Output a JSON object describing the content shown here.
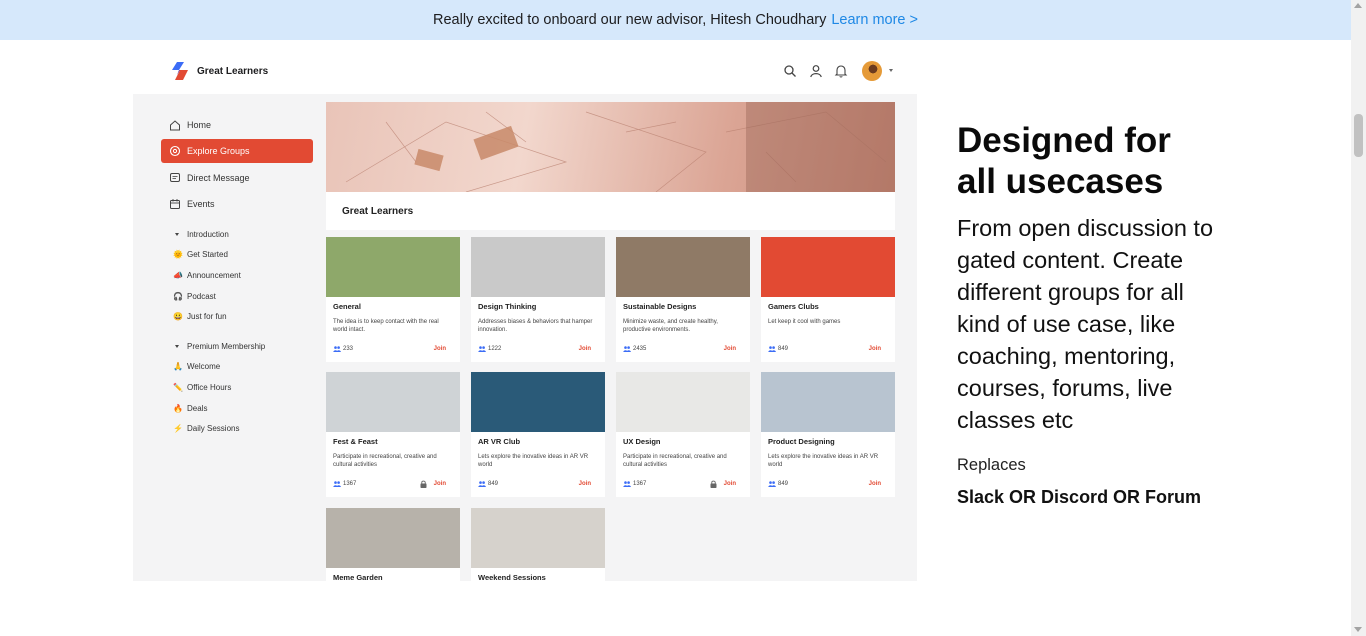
{
  "banner": {
    "text": "Really excited to onboard our new advisor, Hitesh Choudhary",
    "link": "Learn more >"
  },
  "app": {
    "brand": "Great Learners",
    "nav": [
      {
        "label": "Home",
        "icon": "home-icon"
      },
      {
        "label": "Explore Groups",
        "icon": "explore-icon",
        "active": true
      },
      {
        "label": "Direct Message",
        "icon": "message-icon"
      },
      {
        "label": "Events",
        "icon": "calendar-icon"
      }
    ],
    "sections": [
      {
        "title": "Introduction",
        "channels": [
          {
            "emoji": "🌞",
            "label": "Get Started"
          },
          {
            "emoji": "📣",
            "label": "Announcement"
          },
          {
            "emoji": "🎧",
            "label": "Podcast"
          },
          {
            "emoji": "😀",
            "label": "Just for fun"
          }
        ]
      },
      {
        "title": "Premium Membership",
        "channels": [
          {
            "emoji": "🙏",
            "label": "Welcome"
          },
          {
            "emoji": "✏️",
            "label": "Office Hours"
          },
          {
            "emoji": "🔥",
            "label": "Deals"
          },
          {
            "emoji": "⚡",
            "label": "Daily Sessions"
          }
        ]
      }
    ],
    "hero_title": "Great Learners",
    "groups": [
      {
        "title": "General",
        "desc": "The idea is to keep contact with the real world intact.",
        "members": "233",
        "join": "Join",
        "locked": false,
        "color": "#8ea86a"
      },
      {
        "title": "Design Thinking",
        "desc": "Addresses biases & behaviors that hamper innovation.",
        "members": "1222",
        "join": "Join",
        "locked": false,
        "color": "#c9c9c9"
      },
      {
        "title": "Sustainable Designs",
        "desc": "Minimize waste, and create healthy, productive environments.",
        "members": "2435",
        "join": "Join",
        "locked": false,
        "color": "#8f7a66"
      },
      {
        "title": "Gamers Clubs",
        "desc": "Let keep it cool with games",
        "members": "849",
        "join": "Join",
        "locked": false,
        "color": "#e24a33"
      },
      {
        "title": "Fest & Feast",
        "desc": "Participate in recreational, creative and cultural activities",
        "members": "1367",
        "join": "Join",
        "locked": true,
        "color": "#cfd3d6"
      },
      {
        "title": "AR VR Club",
        "desc": "Lets explore the inovative ideas in AR VR world",
        "members": "849",
        "join": "Join",
        "locked": false,
        "color": "#2a5a78"
      },
      {
        "title": "UX Design",
        "desc": "Participate in recreational, creative and cultural activities",
        "members": "1367",
        "join": "Join",
        "locked": true,
        "color": "#e8e8e6"
      },
      {
        "title": "Product Designing",
        "desc": "Lets explore the inovative ideas in AR VR world",
        "members": "849",
        "join": "Join",
        "locked": false,
        "color": "#b8c4d0"
      },
      {
        "title": "Meme Garden",
        "desc": "",
        "members": "",
        "join": "",
        "locked": false,
        "color": "#b7b2aa"
      },
      {
        "title": "Weekend Sessions",
        "desc": "",
        "members": "",
        "join": "",
        "locked": false,
        "color": "#d6d2cc"
      }
    ]
  },
  "marketing": {
    "headline": "Designed for all usecases",
    "description": "From open discussion to gated content. Create different groups for all kind of use case, like coaching, mentoring, courses, forums, live classes etc",
    "replaces_label": "Replaces",
    "replaces_value": "Slack OR Discord OR Forum"
  }
}
